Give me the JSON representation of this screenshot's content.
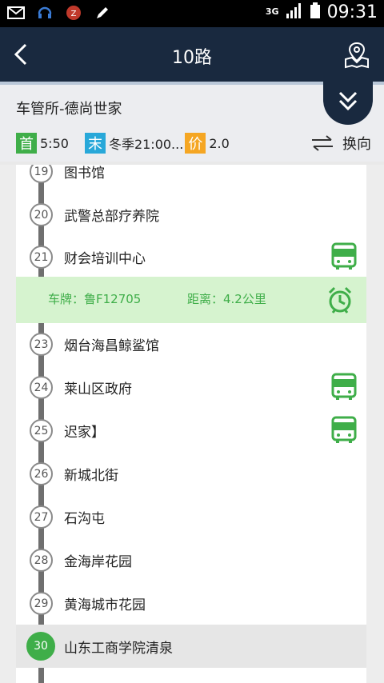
{
  "status_bar": {
    "time": "09:31",
    "network": "3G",
    "icons": [
      "mail-icon",
      "headset-icon",
      "weather-icon",
      "pencil-icon",
      "signal-icon",
      "battery-icon"
    ]
  },
  "header": {
    "title": "10路",
    "icons": [
      "back-icon",
      "map-pin-icon"
    ]
  },
  "route": {
    "name": "车管所-德尚世家",
    "first_tag": "首",
    "first_time": "5:50",
    "last_tag": "末",
    "last_time": "冬季21:00...",
    "price_tag": "价",
    "price": "2.0",
    "switch_label": "换向"
  },
  "stations": [
    {
      "num": "19",
      "name": "图书馆",
      "bus": false
    },
    {
      "num": "20",
      "name": "武警总部疗养院",
      "bus": false
    },
    {
      "num": "21",
      "name": "财会培训中心",
      "bus": true
    },
    {
      "num": "23",
      "name": "烟台海昌鲸鲨馆",
      "bus": false
    },
    {
      "num": "24",
      "name": "莱山区政府",
      "bus": true
    },
    {
      "num": "25",
      "name": "迟家】",
      "bus": true
    },
    {
      "num": "26",
      "name": "新城北街",
      "bus": false
    },
    {
      "num": "27",
      "name": "石沟屯",
      "bus": false
    },
    {
      "num": "28",
      "name": "金海岸花园",
      "bus": false
    },
    {
      "num": "29",
      "name": "黄海城市花园",
      "bus": false
    },
    {
      "num": "30",
      "name": "山东工商学院清泉",
      "bus": false,
      "current": true
    }
  ],
  "bus_info": {
    "plate": "车牌：鲁F12705",
    "distance": "距离：4.2公里"
  },
  "colors": {
    "header_bg": "#19293f",
    "accent_green": "#3fae49",
    "last_blue": "#28a8d9",
    "price_orange": "#f5a623",
    "info_bar_bg": "#d6f3cf"
  }
}
